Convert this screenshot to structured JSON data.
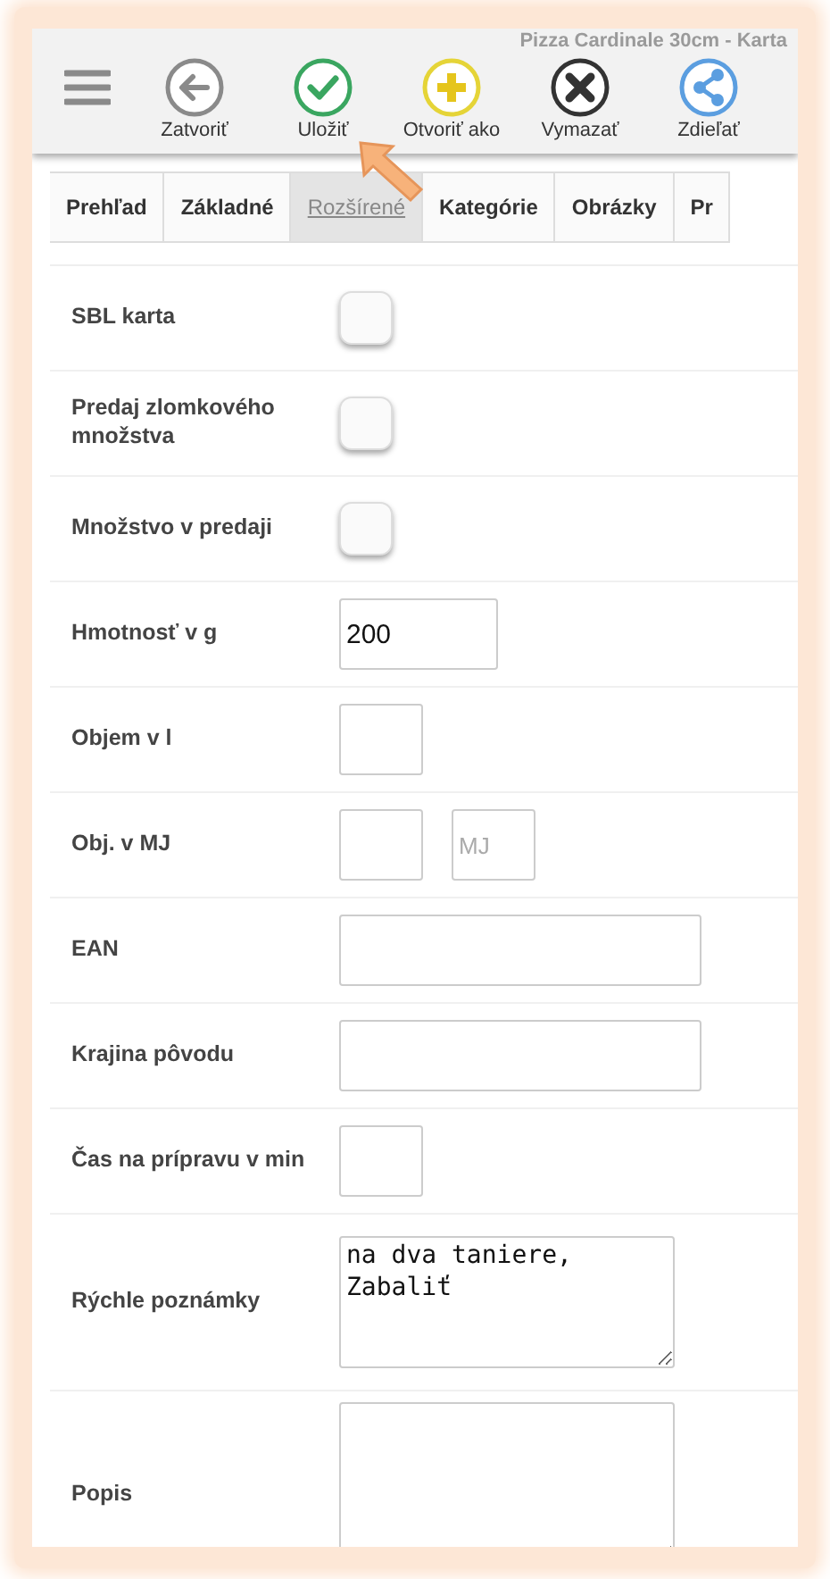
{
  "title": "Pizza Cardinale 30cm - Karta",
  "toolbar": [
    {
      "label": "Zatvoriť",
      "kind": "back"
    },
    {
      "label": "Uložiť",
      "kind": "save"
    },
    {
      "label": "Otvoriť ako",
      "kind": "add"
    },
    {
      "label": "Vymazať",
      "kind": "delete"
    },
    {
      "label": "Zdieľať",
      "kind": "share"
    }
  ],
  "tabs": [
    {
      "label": "Prehľad",
      "selected": false
    },
    {
      "label": "Základné",
      "selected": false
    },
    {
      "label": "Rozšírené",
      "selected": true
    },
    {
      "label": "Kategórie",
      "selected": false
    },
    {
      "label": "Obrázky",
      "selected": false
    },
    {
      "label": "Pr",
      "selected": false
    }
  ],
  "fields": [
    {
      "label": "SBL karta",
      "kind": "checkbox",
      "checked": false
    },
    {
      "label": "Predaj zlomkového množstva",
      "kind": "checkbox",
      "checked": false
    },
    {
      "label": "Množstvo v predaji",
      "kind": "checkbox",
      "checked": false
    },
    {
      "label": "Hmotnosť v g",
      "kind": "medium",
      "value": "200"
    },
    {
      "label": "Objem v l",
      "kind": "short"
    },
    {
      "label": "Obj. v MJ",
      "kind": "pair",
      "placeholder": "MJ"
    },
    {
      "label": "EAN",
      "kind": "long"
    },
    {
      "label": "Krajina pôvodu",
      "kind": "long"
    },
    {
      "label": "Čas na prípravu v min",
      "kind": "short"
    },
    {
      "label": "Rýchle poznámky",
      "kind": "textarea",
      "value": "na dva taniere,\nZabaliť"
    },
    {
      "label": "Popis",
      "kind": "textarea"
    }
  ]
}
